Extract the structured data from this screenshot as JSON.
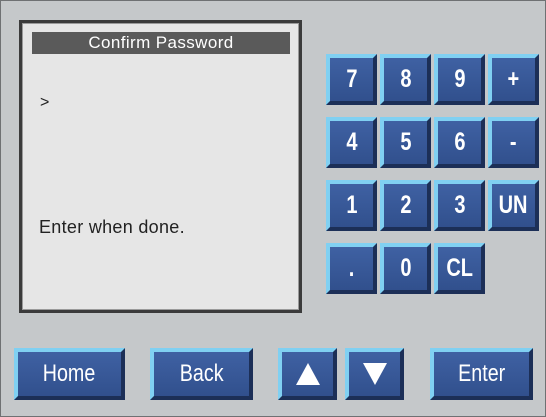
{
  "display": {
    "title": "Confirm Password",
    "prompt": ">",
    "hint": "Enter when done."
  },
  "keypad": {
    "row1": [
      "7",
      "8",
      "9",
      "+"
    ],
    "row2": [
      "4",
      "5",
      "6",
      "-"
    ],
    "row3": [
      "1",
      "2",
      "3",
      "UN"
    ],
    "row4": [
      ".",
      "0",
      "CL"
    ]
  },
  "nav": {
    "home": "Home",
    "back": "Back",
    "up_icon": "up-arrow-icon",
    "down_icon": "down-arrow-icon",
    "enter": "Enter"
  },
  "colors": {
    "background": "#c5c8ca",
    "button_face": "#3a5a9a",
    "button_highlight": "#80d0f2",
    "title_bar": "#5a5a5a"
  }
}
